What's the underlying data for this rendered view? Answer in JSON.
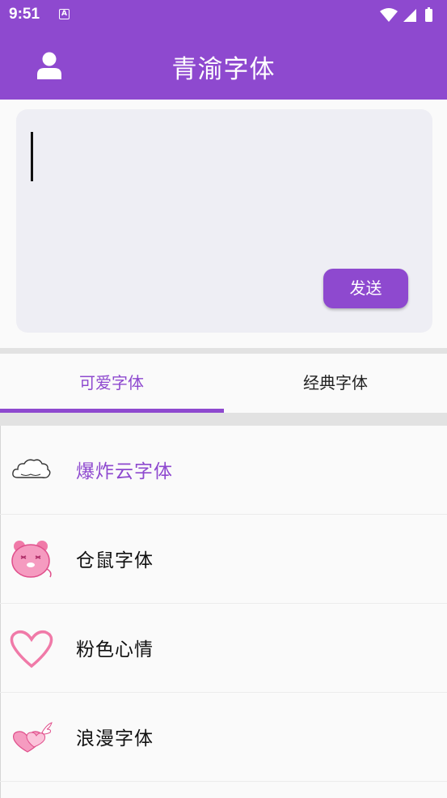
{
  "status_bar": {
    "time": "9:51",
    "notification_icon": "A"
  },
  "app_bar": {
    "title": "青渝字体"
  },
  "composer": {
    "send_label": "发送",
    "value": ""
  },
  "tabs": [
    {
      "label": "可爱字体",
      "selected": true
    },
    {
      "label": "经典字体",
      "selected": false
    }
  ],
  "fonts": [
    {
      "label": "爆炸云字体",
      "icon": "cloud-icon"
    },
    {
      "label": "仓鼠字体",
      "icon": "hamster-icon"
    },
    {
      "label": "粉色心情",
      "icon": "pink-heart-icon"
    },
    {
      "label": "浪漫字体",
      "icon": "winged-hearts-icon"
    }
  ],
  "colors": {
    "accent": "#8e49cf",
    "pink": "#f07aa8"
  }
}
